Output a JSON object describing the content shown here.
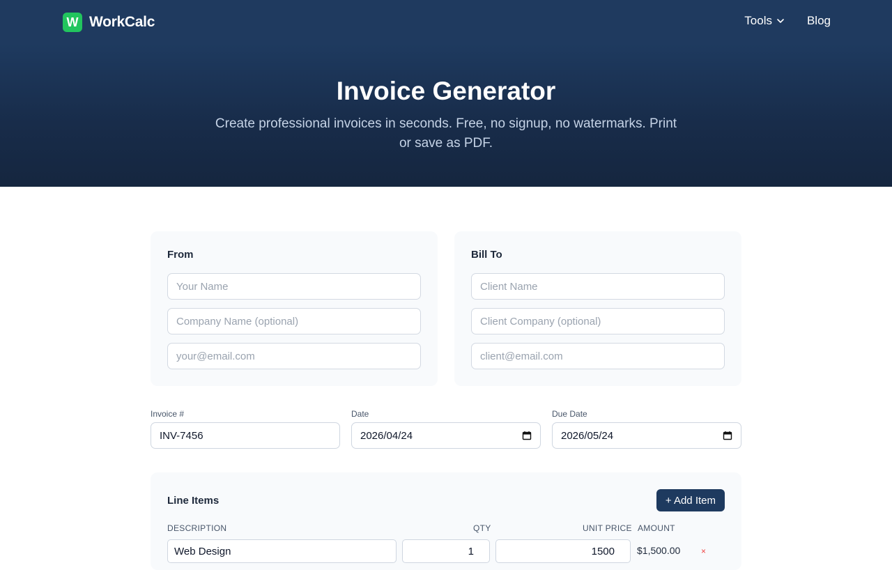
{
  "brand": {
    "badge": "W",
    "name": "WorkCalc",
    "accent": "#22c55e",
    "header_bg": "#1f3a5f"
  },
  "nav": {
    "tools": "Tools",
    "blog": "Blog"
  },
  "hero": {
    "title": "Invoice Generator",
    "subtitle": "Create professional invoices in seconds. Free, no signup, no watermarks. Print or save as PDF."
  },
  "from": {
    "title": "From",
    "name_placeholder": "Your Name",
    "company_placeholder": "Company Name (optional)",
    "email_placeholder": "your@email.com"
  },
  "bill_to": {
    "title": "Bill To",
    "name_placeholder": "Client Name",
    "company_placeholder": "Client Company (optional)",
    "email_placeholder": "client@email.com"
  },
  "meta": {
    "invoice_label": "Invoice #",
    "invoice_value": "INV-7456",
    "date_label": "Date",
    "date_value": "2026/04/24",
    "due_label": "Due Date",
    "due_value": "2026/05/24"
  },
  "line_items": {
    "title": "Line Items",
    "add_button": "+ Add Item",
    "headers": {
      "description": "DESCRIPTION",
      "qty": "QTY",
      "unit_price": "UNIT PRICE",
      "amount": "AMOUNT"
    },
    "rows": [
      {
        "description": "Web Design",
        "qty": "1",
        "unit_price": "1500",
        "amount": "$1,500.00",
        "remove": "×"
      }
    ]
  }
}
